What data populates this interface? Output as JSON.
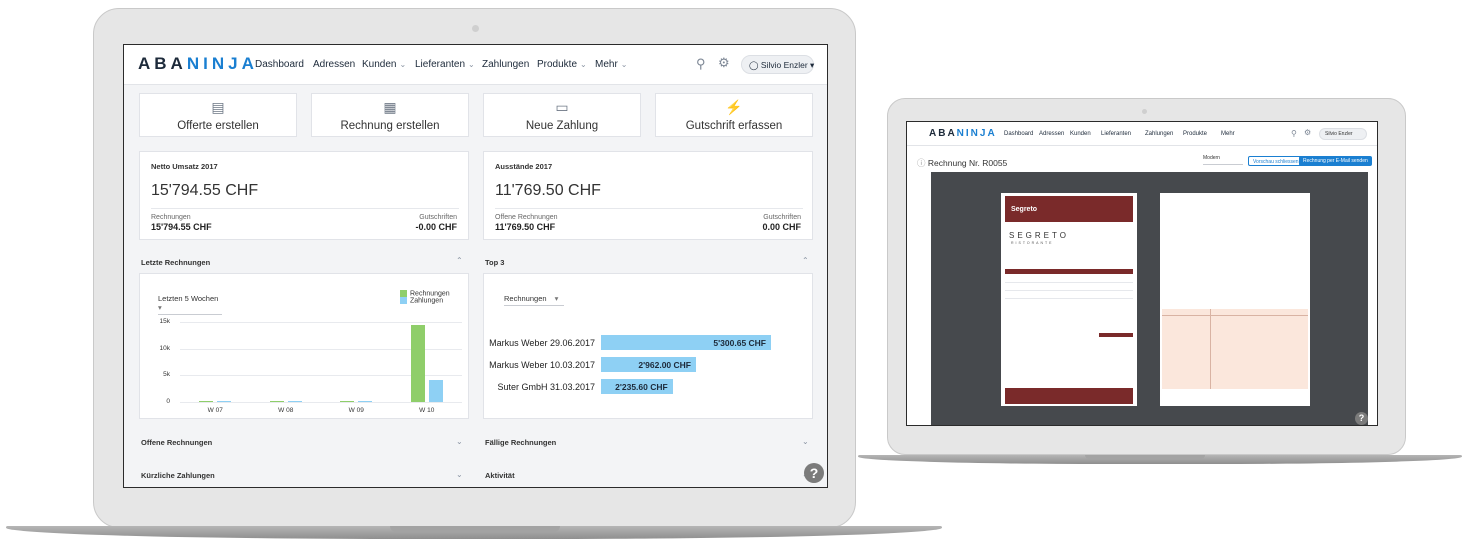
{
  "main_app": {
    "logo": {
      "part1": "ABA",
      "part2": "NINJA"
    },
    "nav": {
      "items": [
        {
          "label": "Dashboard",
          "dropdown": false
        },
        {
          "label": "Adressen",
          "dropdown": false
        },
        {
          "label": "Kunden",
          "dropdown": true
        },
        {
          "label": "Lieferanten",
          "dropdown": true
        },
        {
          "label": "Zahlungen",
          "dropdown": false
        },
        {
          "label": "Produkte",
          "dropdown": true
        },
        {
          "label": "Mehr",
          "dropdown": true
        }
      ],
      "search_icon": "search-icon",
      "settings_icon": "gear-icon",
      "user_name": "Silvio Enzler"
    },
    "quick_actions": [
      {
        "label": "Offerte erstellen",
        "icon": "offer-icon"
      },
      {
        "label": "Rechnung erstellen",
        "icon": "invoice-icon"
      },
      {
        "label": "Neue Zahlung",
        "icon": "payment-card-icon"
      },
      {
        "label": "Gutschrift erfassen",
        "icon": "lightning-icon"
      }
    ],
    "kpi_left": {
      "title": "Netto Umsatz 2017",
      "value": "15'794.55 CHF",
      "left_label": "Rechnungen",
      "left_value": "15'794.55 CHF",
      "right_label": "Gutschriften",
      "right_value": "-0.00 CHF"
    },
    "kpi_right": {
      "title": "Ausstände 2017",
      "value": "11'769.50 CHF",
      "left_label": "Offene Rechnungen",
      "left_value": "11'769.50 CHF",
      "right_label": "Gutschriften",
      "right_value": "0.00 CHF"
    },
    "section_recent": {
      "title": "Letzte Rechnungen",
      "dropdown": "Letzten 5 Wochen",
      "legend": [
        "Rechnungen",
        "Zahlungen"
      ]
    },
    "section_top3": {
      "title": "Top 3",
      "dropdown": "Rechnungen"
    },
    "sections_collapsed": [
      "Offene Rechnungen",
      "Fällige Rechnungen",
      "Kürzliche Zahlungen",
      "Aktivität"
    ],
    "help": "?"
  },
  "chart_data": [
    {
      "type": "bar",
      "title": "",
      "categories": [
        "W 07",
        "W 08",
        "W 09",
        "W 10"
      ],
      "series": [
        {
          "name": "Rechnungen",
          "values": [
            0,
            0,
            0,
            14500
          ]
        },
        {
          "name": "Zahlungen",
          "values": [
            0,
            0,
            0,
            4200
          ]
        }
      ],
      "y_ticks": [
        "15k",
        "10k",
        "5k",
        "0"
      ],
      "ylim": [
        0,
        15000
      ],
      "grid": true,
      "legend": "top-right",
      "colors": [
        "#8fce6a",
        "#8ed0f4"
      ]
    },
    {
      "type": "bar",
      "orientation": "horizontal",
      "categories": [
        "Markus Weber 29.06.2017",
        "Markus Weber 10.03.2017",
        "Suter GmbH 31.03.2017"
      ],
      "values": [
        5300.65,
        2962.0,
        2235.6
      ],
      "value_labels": [
        "5'300.65 CHF",
        "2'962.00 CHF",
        "2'235.60 CHF"
      ],
      "colors": [
        "#8ed0f4"
      ]
    }
  ],
  "second_app": {
    "logo": {
      "part1": "ABA",
      "part2": "NINJA"
    },
    "nav": [
      "Dashboard",
      "Adressen",
      "Kunden",
      "Lieferanten",
      "Zahlungen",
      "Produkte",
      "Mehr"
    ],
    "user_name": "Silvio Enzler",
    "invoice_title": "Rechnung Nr. R0055",
    "template_select": "Modern",
    "btn_close_preview": "Vorschau schliessen",
    "btn_send_email": "Rechnung per E-Mail senden",
    "doc_header_brand": "Segreto",
    "doc_logo_text": "SEGRETO",
    "doc_logo_sub": "RISTORANTE",
    "help": "?"
  }
}
